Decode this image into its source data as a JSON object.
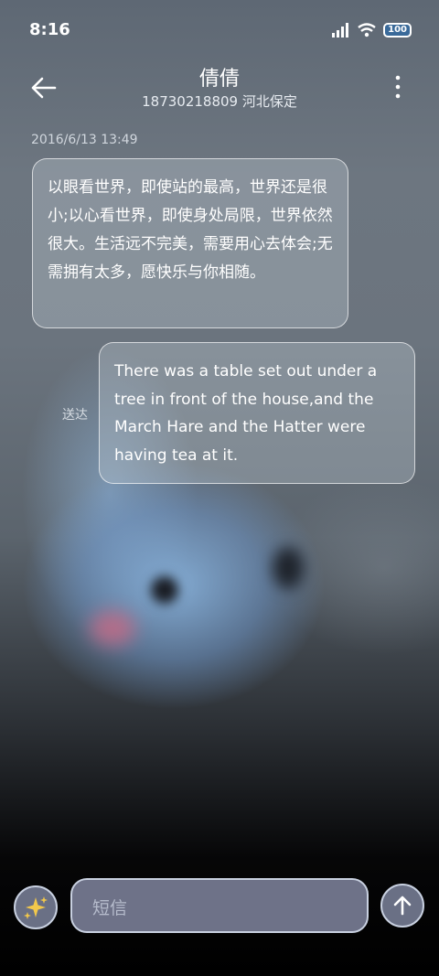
{
  "status_bar": {
    "time": "8:16",
    "battery": "100",
    "icons": [
      "signal-icon",
      "wifi-icon",
      "battery-icon"
    ]
  },
  "header": {
    "title": "倩倩",
    "subtitle": "18730218809 河北保定",
    "icons": [
      "back-arrow-icon",
      "more-vertical-icon"
    ]
  },
  "conversation": {
    "date": "2016/6/13 13:49",
    "messages": [
      {
        "direction": "incoming",
        "text": "以眼看世界，即使站的最高，世界还是很小;以心看世界，即使身处局限，世界依然很大。生活远不完美，需要用心去体会;无需拥有太多，愿快乐与你相随。"
      },
      {
        "direction": "outgoing",
        "status": "送达",
        "text": "There was a table set out under a tree in front of the house,and the March Hare and the Hatter were having tea at it."
      }
    ]
  },
  "composer": {
    "placeholder": "短信",
    "left_icon": "sparkle-icon",
    "send_icon": "send-arrow-icon"
  }
}
